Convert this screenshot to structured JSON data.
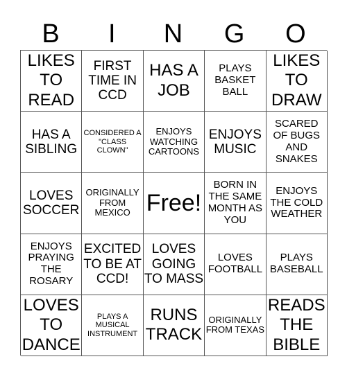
{
  "title_letters": [
    "B",
    "I",
    "N",
    "G",
    "O"
  ],
  "cells": [
    [
      "LIKES TO READ",
      "FIRST TIME IN CCD",
      "HAS A JOB",
      "PLAYS BASKET BALL",
      "LIKES TO DRAW"
    ],
    [
      "HAS A SIBLING",
      "CONSIDERED A \"CLASS CLOWN\"",
      "ENJOYS WATCHING CARTOONS",
      "ENJOYS MUSIC",
      "SCARED OF BUGS AND SNAKES"
    ],
    [
      "LOVES SOCCER",
      "ORIGINALLY FROM MEXICO",
      "Free!",
      "BORN IN THE SAME MONTH AS YOU",
      "ENJOYS THE COLD WEATHER"
    ],
    [
      "ENJOYS PRAYING THE ROSARY",
      "EXCITED TO BE AT CCD!",
      "LOVES GOING TO MASS",
      "LOVES FOOTBALL",
      "PLAYS BASEBALL"
    ],
    [
      "LOVES TO DANCE",
      "PLAYS A MUSICAL INSTRUMENT",
      "RUNS TRACK",
      "ORIGINALLY FROM TEXAS",
      "READS THE BIBLE"
    ]
  ]
}
